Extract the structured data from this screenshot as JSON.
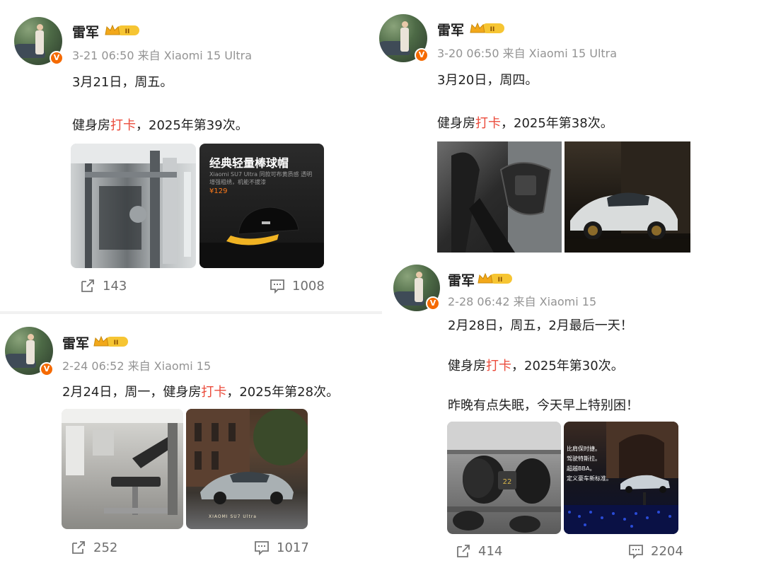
{
  "posts": [
    {
      "user": "雷军",
      "verified": "V",
      "meta": "3-21 06:50  来自 Xiaomi 15 Ultra",
      "lines": [
        {
          "pre": "3月21日，周五。",
          "hl": "",
          "post": ""
        },
        {
          "pre": "健身房",
          "hl": "打卡",
          "post": "，2025年第39次。"
        }
      ],
      "images": [
        {
          "title": "",
          "sub": "",
          "price": ""
        },
        {
          "title": "经典轻量棒球帽",
          "sub": "Xiaomi SU7 Ultra 同款可布黄质感 透明增强粗绣，机能不拔漆",
          "price": "¥129"
        }
      ],
      "repost": "143",
      "comments": "1008"
    },
    {
      "user": "雷军",
      "verified": "V",
      "meta": "3-20 06:50  来自 Xiaomi 15 Ultra",
      "lines": [
        {
          "pre": "3月20日，周四。",
          "hl": "",
          "post": ""
        },
        {
          "pre": "健身房",
          "hl": "打卡",
          "post": "，2025年第38次。"
        }
      ]
    },
    {
      "user": "雷军",
      "verified": "V",
      "meta": "2-24 06:52  来自 Xiaomi 15",
      "lines": [
        {
          "pre": "2月24日，周一，健身房",
          "hl": "打卡",
          "post": "，2025年第28次。"
        }
      ],
      "images": [
        {
          "caption": ""
        },
        {
          "caption": "XIAOMI SU7 Ultra"
        }
      ],
      "repost": "252",
      "comments": "1017"
    },
    {
      "user": "雷军",
      "verified": "V",
      "meta": "2-28 06:42  来自 Xiaomi 15",
      "lines": [
        {
          "pre": "2月28日，周五，2月最后一天！",
          "hl": "",
          "post": ""
        },
        {
          "pre": "健身房",
          "hl": "打卡",
          "post": "，2025年第30次。"
        },
        {
          "pre": "昨晚有点失眠，今天早上特别困！",
          "hl": "",
          "post": ""
        }
      ],
      "images": [
        {
          "caption": ""
        },
        {
          "text": "比肩保时捷。\n驾驶特斯拉。\n超越BBA。\n定义豪车新标准。"
        }
      ],
      "repost": "414",
      "comments": "2204"
    }
  ],
  "icons": {
    "repost": "share-arrow-icon",
    "comment": "comment-bubble-icon",
    "verified": "verified-badge-icon",
    "level": "crown-level-icon"
  },
  "colors": {
    "highlight": "#eb4b3b",
    "meta": "#939393",
    "verified": "#f56a00",
    "crown": "#f2b21a"
  }
}
